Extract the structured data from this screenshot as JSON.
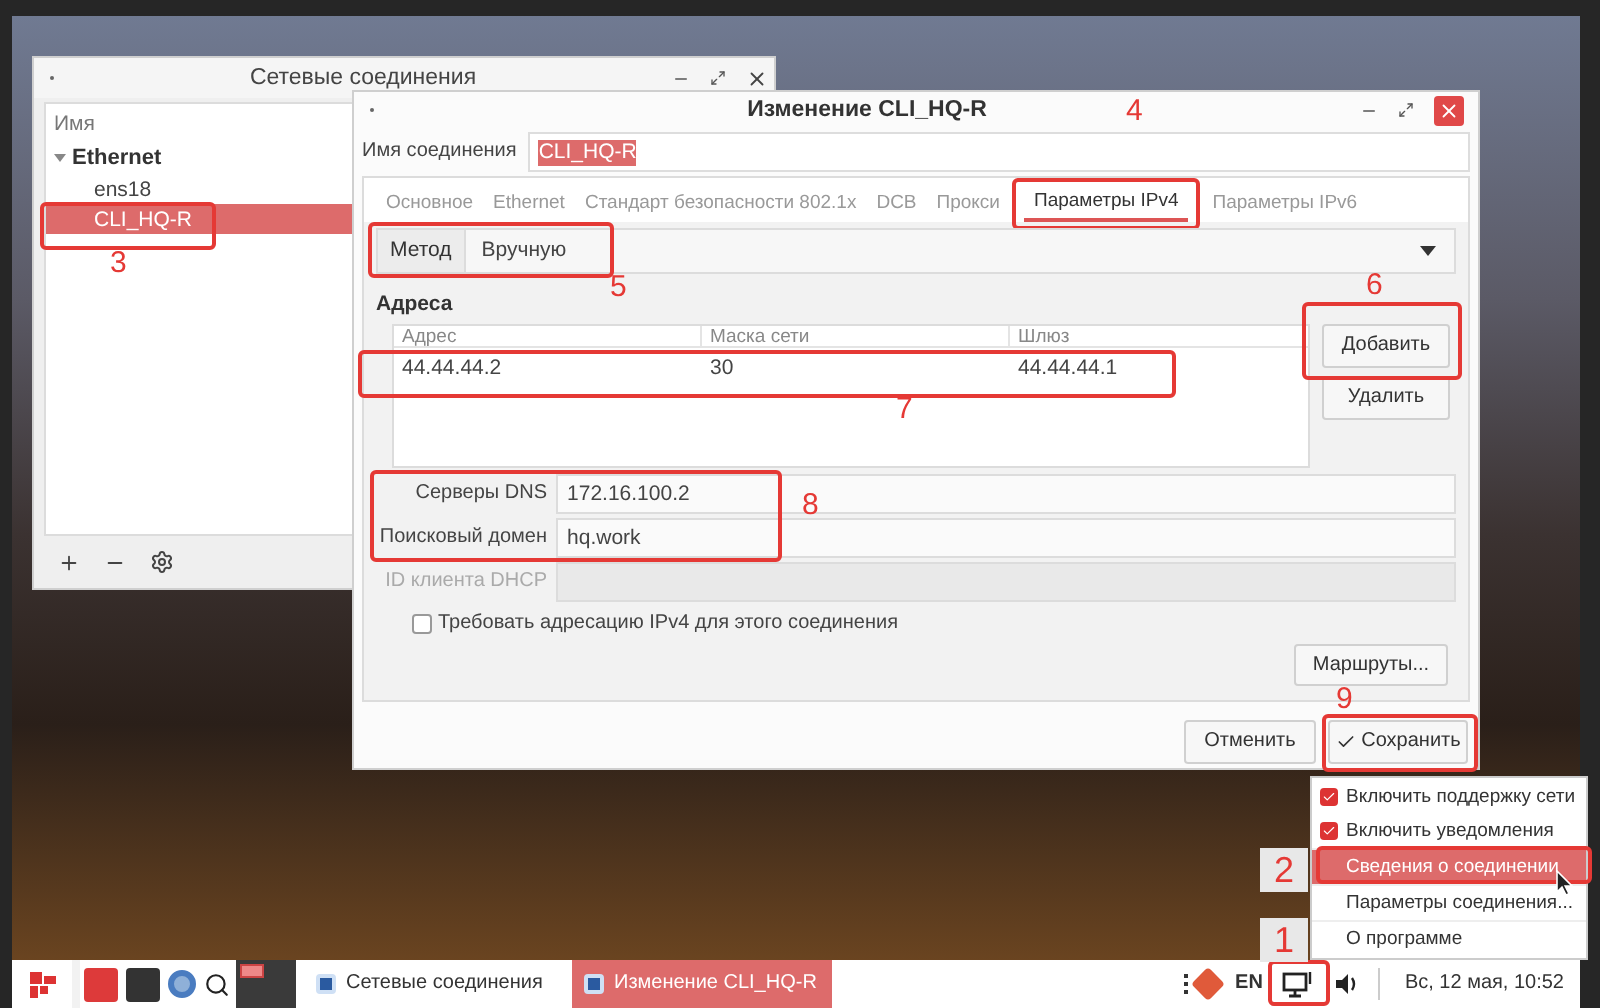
{
  "connections_window": {
    "title": "Сетевые соединения",
    "column": "Имя",
    "groups": [
      {
        "label": "Ethernet",
        "expanded": true,
        "children": [
          {
            "label": "ens18",
            "selected": false
          },
          {
            "label": "CLI_HQ-R",
            "selected": true
          }
        ]
      }
    ]
  },
  "editor": {
    "title": "Изменение CLI_HQ-R",
    "connection_name": {
      "label": "Имя соединения",
      "value": "CLI_HQ-R",
      "highlighted": true
    },
    "tabs": [
      {
        "label": "Основное",
        "selected": false
      },
      {
        "label": "Ethernet",
        "selected": false
      },
      {
        "label": "Стандарт безопасности 802.1x",
        "selected": false
      },
      {
        "label": "DCB",
        "selected": false
      },
      {
        "label": "Прокси",
        "selected": false
      },
      {
        "label": "Параметры IPv4",
        "selected": true
      },
      {
        "label": "Параметры IPv6",
        "selected": false
      }
    ],
    "method": {
      "label": "Метод",
      "value": "Вручную"
    },
    "addresses": {
      "title": "Адреса",
      "columns": [
        "Адрес",
        "Маска сети",
        "Шлюз"
      ],
      "rows": [
        [
          "44.44.44.2",
          "30",
          "44.44.44.1"
        ]
      ]
    },
    "add_button": "Добавить",
    "remove_button": "Удалить",
    "fields": [
      {
        "label": "Серверы DNS",
        "value": "172.16.100.2",
        "disabled": false
      },
      {
        "label": "Поисковый домен",
        "value": "hq.work",
        "disabled": false
      },
      {
        "label": "ID клиента DHCP",
        "disabled": true
      }
    ],
    "require_ipv4": {
      "label": "Требовать адресацию IPv4 для этого соединения",
      "checked": false
    },
    "routes_button": "Маршруты...",
    "cancel_button": "Отменить",
    "save_button": "Сохранить"
  },
  "tray_menu": [
    {
      "kind": "checkbox",
      "label": "Включить поддержку сети",
      "checked": true
    },
    {
      "kind": "checkbox",
      "label": "Включить уведомления",
      "checked": true
    },
    {
      "kind": "item",
      "label": "Сведения о соединении",
      "selected": true
    },
    {
      "kind": "item",
      "label": "Параметры соединения...",
      "selected": false
    },
    {
      "kind": "item",
      "label": "О программе",
      "selected": false
    }
  ],
  "taskbar": {
    "tasks": [
      {
        "label": "Сетевые соединения",
        "selected": false
      },
      {
        "label": "Изменение CLI_HQ-R",
        "selected": true
      }
    ],
    "language": "EN",
    "clock": "Вс, 12 мая, 10:52"
  },
  "annotations": [
    {
      "number": "1",
      "kind": "tile"
    },
    {
      "number": "2",
      "kind": "tile"
    },
    {
      "number": "3",
      "kind": "plain"
    },
    {
      "number": "4",
      "kind": "plain"
    },
    {
      "number": "5",
      "kind": "plain"
    },
    {
      "number": "6",
      "kind": "plain"
    },
    {
      "number": "7",
      "kind": "plain"
    },
    {
      "number": "8",
      "kind": "plain"
    },
    {
      "number": "9",
      "kind": "plain"
    }
  ]
}
